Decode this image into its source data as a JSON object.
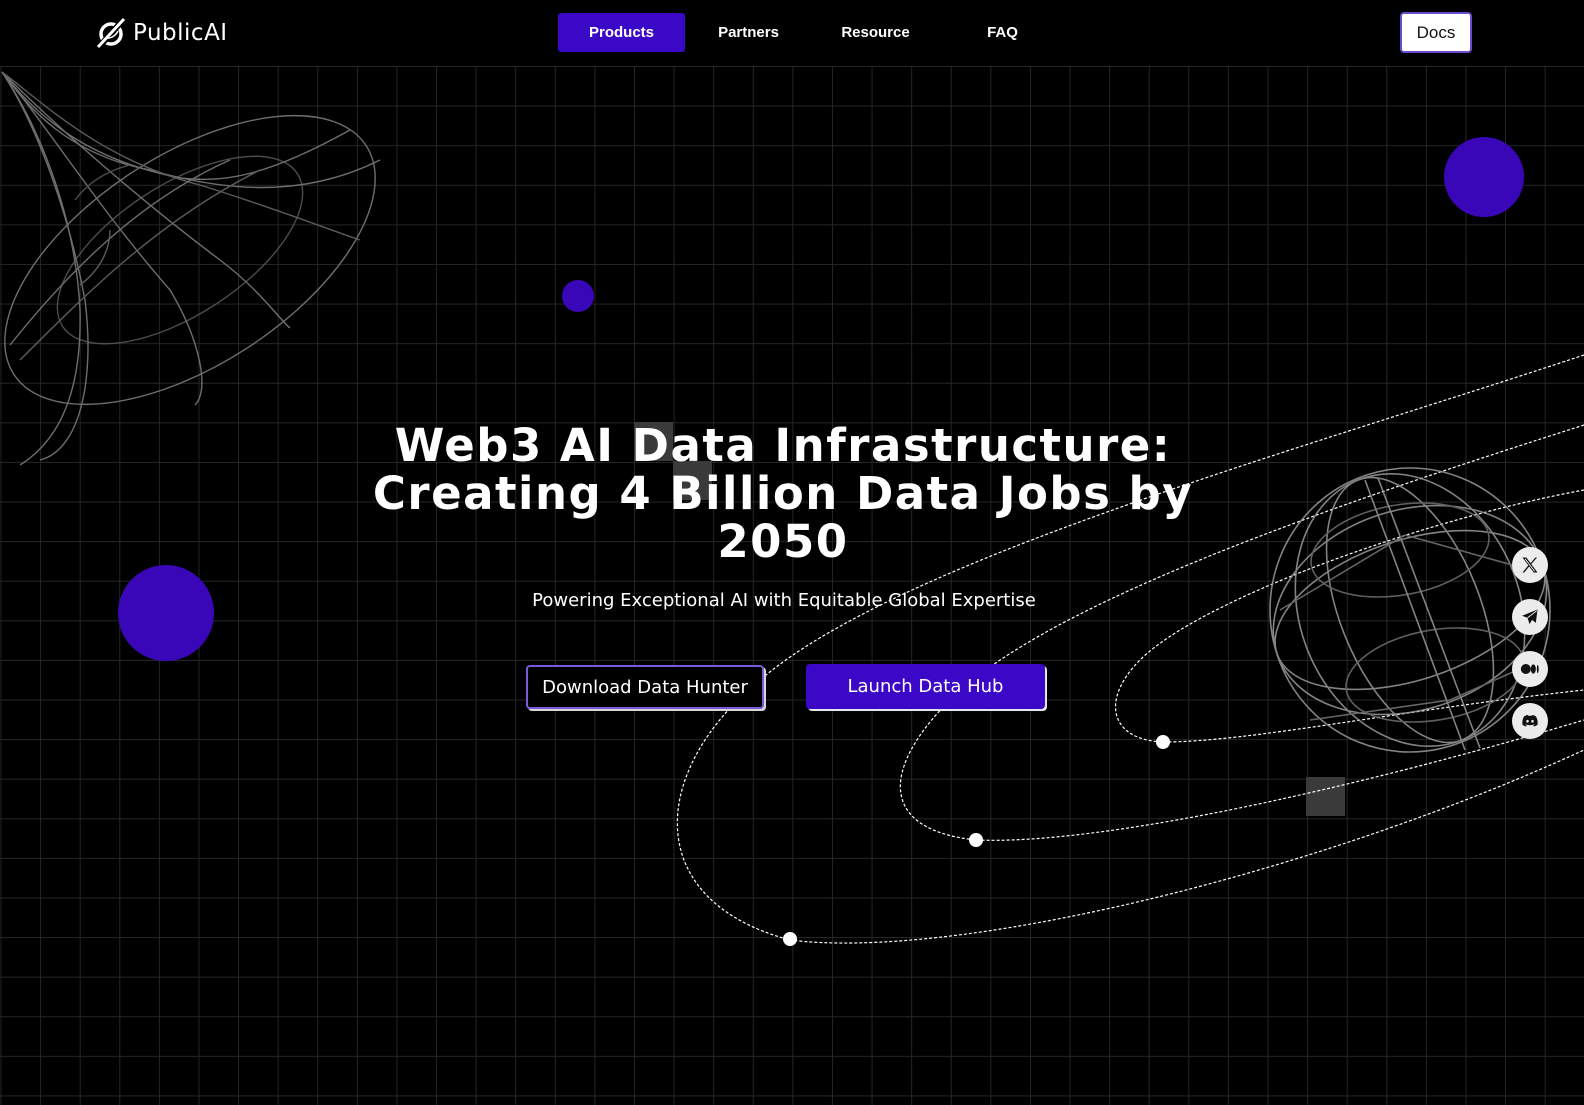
{
  "header": {
    "brand": "PublicAI",
    "nav": [
      {
        "label": "Products",
        "active": true
      },
      {
        "label": "Partners",
        "active": false
      },
      {
        "label": "Resource",
        "active": false
      },
      {
        "label": "FAQ",
        "active": false
      }
    ],
    "docs_label": "Docs"
  },
  "hero": {
    "title_line1": "Web3 AI Data Infrastructure:",
    "title_line2": "Creating 4 Billion Data Jobs by",
    "title_line3": "2050",
    "subtitle": "Powering Exceptional AI with Equitable Global Expertise",
    "primary_cta": "Launch Data Hub",
    "secondary_cta": "Download Data Hunter"
  },
  "social": [
    {
      "name": "x-twitter",
      "icon": "x-icon"
    },
    {
      "name": "telegram",
      "icon": "telegram-icon"
    },
    {
      "name": "medium",
      "icon": "medium-icon"
    },
    {
      "name": "discord",
      "icon": "discord-icon"
    }
  ],
  "colors": {
    "accent": "#3b08c8",
    "blob": "#3a07b8",
    "background": "#000000",
    "grid": "#262626",
    "social_bg": "#ececec"
  }
}
